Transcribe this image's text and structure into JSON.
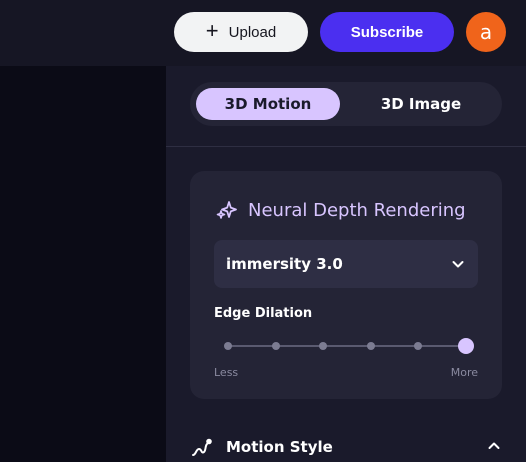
{
  "header": {
    "upload_label": "Upload",
    "subscribe_label": "Subscribe",
    "avatar_letter": "a"
  },
  "mode_tabs": [
    {
      "label": "3D Motion",
      "active": true
    },
    {
      "label": "3D Image",
      "active": false
    }
  ],
  "depth_card": {
    "title": "Neural Depth Rendering",
    "icon": "sparkles-icon",
    "model_selected": "immersity 3.0",
    "edge_dilation": {
      "label": "Edge Dilation",
      "min_label": "Less",
      "max_label": "More",
      "steps": 6,
      "selected_step": 6
    }
  },
  "motion_style": {
    "title": "Motion Style",
    "icon": "motion-path-icon",
    "expanded": true
  },
  "colors": {
    "accent": "#d8c5ff",
    "subscribe": "#4b2ff0",
    "avatar": "#f0641b",
    "panel": "#1a1a2b",
    "card": "#242436"
  }
}
